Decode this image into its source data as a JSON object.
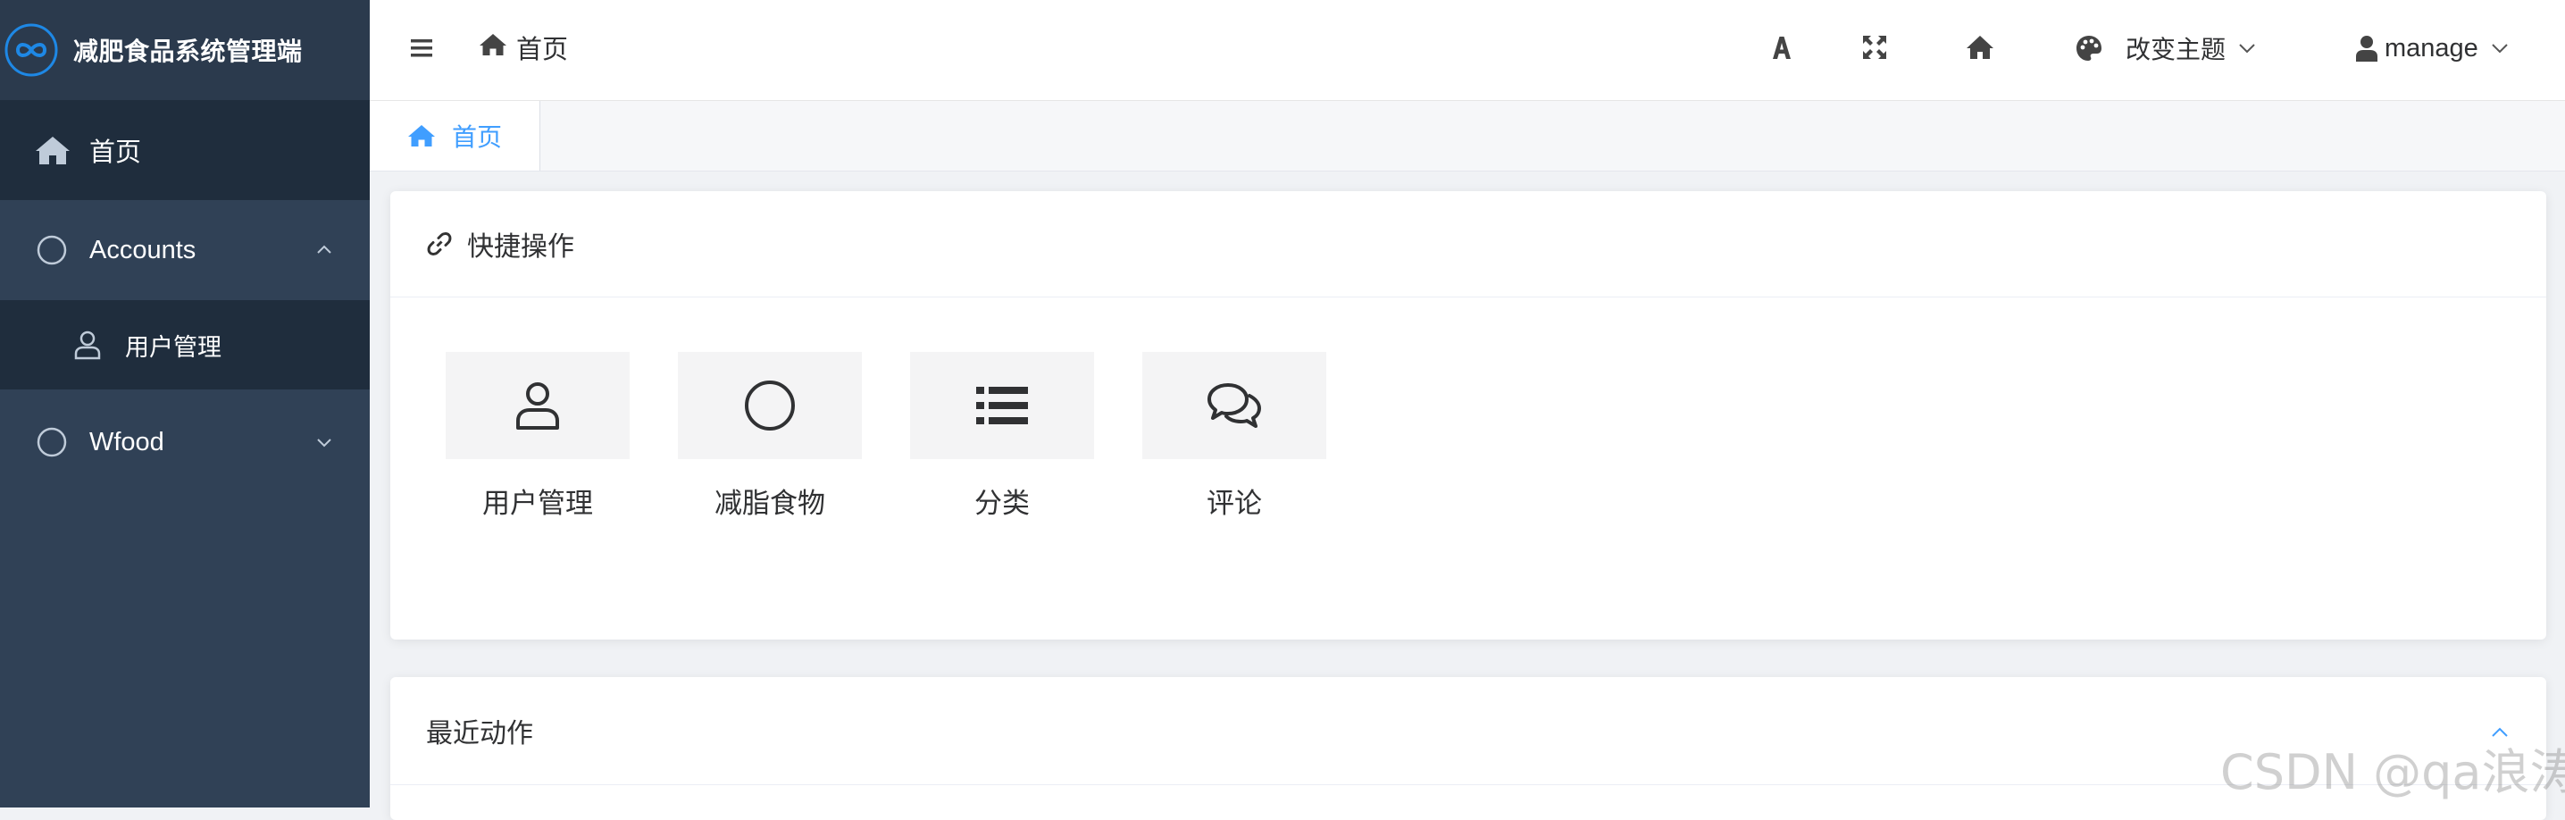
{
  "app": {
    "title": "减肥食品系统管理端"
  },
  "sidebar": {
    "items": [
      {
        "label": "首页",
        "icon": "home-icon"
      },
      {
        "label": "Accounts",
        "icon": "circle-icon",
        "expanded": true,
        "children": [
          {
            "label": "用户管理",
            "icon": "user-icon"
          }
        ]
      },
      {
        "label": "Wfood",
        "icon": "circle-icon",
        "expanded": false
      }
    ]
  },
  "header": {
    "breadcrumb": "首页",
    "theme_label": "改变主题",
    "user_label": "manage",
    "icons": [
      "menu-icon",
      "font-size-icon",
      "fullscreen-icon",
      "home-icon",
      "palette-icon",
      "user-icon"
    ]
  },
  "tags": [
    {
      "label": "首页",
      "active": true
    }
  ],
  "quick_actions": {
    "title": "快捷操作",
    "items": [
      {
        "label": "用户管理",
        "icon": "user-icon"
      },
      {
        "label": "减脂食物",
        "icon": "circle-icon"
      },
      {
        "label": "分类",
        "icon": "list-icon"
      },
      {
        "label": "评论",
        "icon": "comments-icon"
      }
    ]
  },
  "recent_actions": {
    "title": "最近动作"
  },
  "watermark": "CSDN @qa浪涛",
  "colors": {
    "sidebar_bg": "#304156",
    "sidebar_active_bg": "#1f2d3d",
    "accent": "#409eff"
  }
}
